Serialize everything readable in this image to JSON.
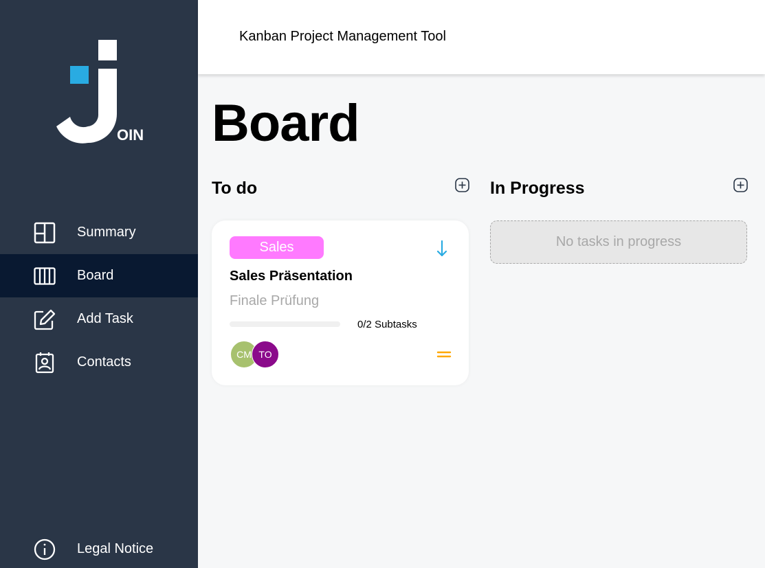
{
  "brand": {
    "logo_text": "OIN"
  },
  "sidebar": {
    "items": [
      {
        "label": "Summary",
        "icon": "summary-icon"
      },
      {
        "label": "Board",
        "icon": "board-icon",
        "active": true
      },
      {
        "label": "Add Task",
        "icon": "add-task-icon"
      },
      {
        "label": "Contacts",
        "icon": "contacts-icon"
      }
    ],
    "legal": {
      "label": "Legal Notice",
      "icon": "info-icon"
    }
  },
  "header": {
    "title": "Kanban Project Management Tool"
  },
  "main": {
    "title": "Board",
    "columns": [
      {
        "title": "To do"
      },
      {
        "title": "In Progress",
        "empty_text": "No tasks in progress"
      }
    ],
    "card": {
      "category": "Sales",
      "category_color": "#ff7aff",
      "title": "Sales Präsentation",
      "description": "Finale Prüfung",
      "subtasks_done": 0,
      "subtasks_total": 2,
      "subtasks_text": "0/2 Subtasks",
      "assignees": [
        {
          "initials": "CM",
          "color": "#a7c16e"
        },
        {
          "initials": "TO",
          "color": "#8b0a8b"
        }
      ],
      "priority": "medium",
      "priority_color": "#ffa800"
    }
  },
  "colors": {
    "sidebar_bg": "#2a3647",
    "sidebar_active": "#091931",
    "accent_blue": "#29abe2"
  }
}
